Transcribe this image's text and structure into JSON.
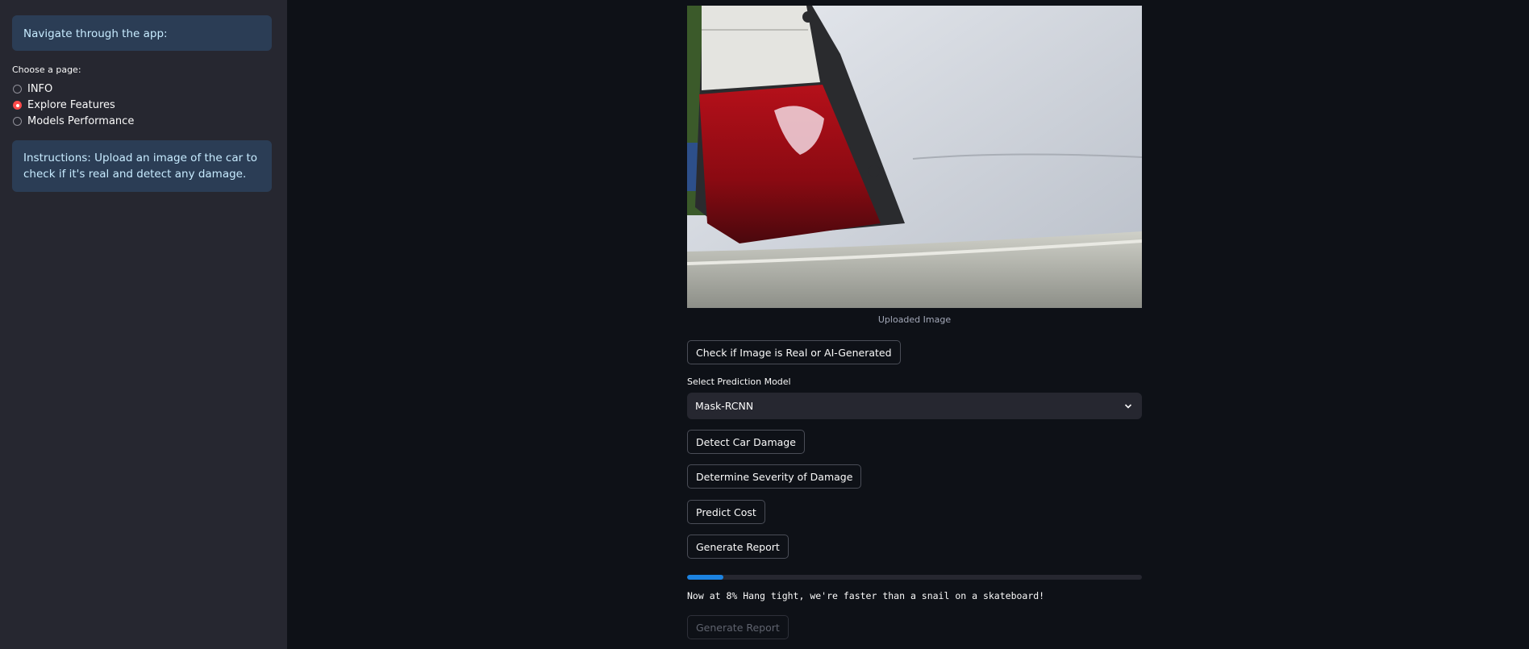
{
  "sidebar": {
    "nav_text": "Navigate through the app:",
    "radio_label": "Choose a page:",
    "pages": [
      {
        "label": "INFO",
        "selected": false
      },
      {
        "label": "Explore Features",
        "selected": true
      },
      {
        "label": "Models Performance",
        "selected": false
      }
    ],
    "instructions": "Instructions: Upload an image of the car to check if it's real and detect any damage."
  },
  "main": {
    "image_caption": "Uploaded Image",
    "check_button": "Check if Image is Real or AI-Generated",
    "select_label": "Select Prediction Model",
    "select_value": "Mask-RCNN",
    "detect_button": "Detect Car Damage",
    "severity_button": "Determine Severity of Damage",
    "cost_button": "Predict Cost",
    "report_button": "Generate Report",
    "progress": 0.08,
    "status_text": "Now at 8% Hang tight, we're faster than a snail on a skateboard!",
    "report_button_disabled": "Generate Report"
  },
  "colors": {
    "accent": "#ff4b4b",
    "progress": "#1c83e1",
    "info_bg": "#2b3d55",
    "background": "#0e1117",
    "sidebar": "#262730"
  }
}
